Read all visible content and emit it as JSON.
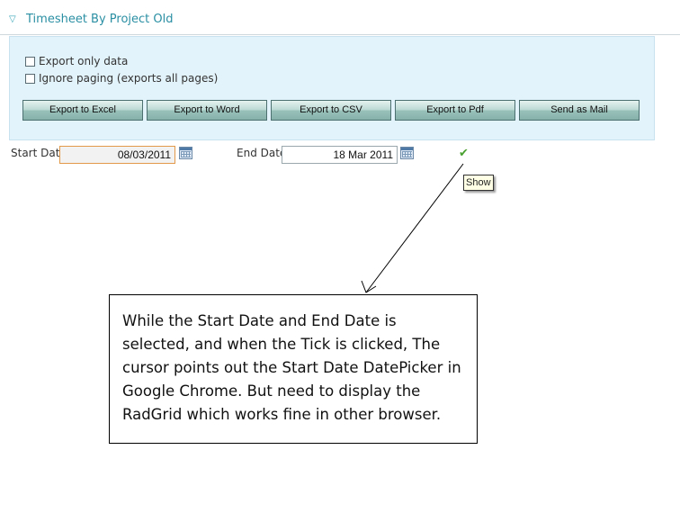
{
  "header": {
    "title": "Timesheet By Project Old",
    "collapse_icon": "triangle-down-icon"
  },
  "export_panel": {
    "export_only_data_label": "Export only data",
    "ignore_paging_label": "Ignore paging (exports all pages)",
    "buttons": {
      "excel": "Export to Excel",
      "word": "Export to Word",
      "csv": "Export to CSV",
      "pdf": "Export to Pdf",
      "mail": "Send as Mail"
    }
  },
  "filters": {
    "start_date_label": "Start Date",
    "start_date_value": "08/03/2011",
    "end_date_label": "End Date",
    "end_date_value": "18 Mar 2011",
    "show_tooltip": "Show"
  },
  "annotation": {
    "text": "While the Start Date and End Date is selected, and when the Tick is clicked, The cursor points out the Start Date DatePicker in Google Chrome. But need to display the RadGrid which works fine in other browser."
  },
  "colors": {
    "title": "#2a8fa3",
    "panel_bg": "#e3f3fb",
    "focus_border": "#e29a4a",
    "tick": "#4aa030"
  }
}
